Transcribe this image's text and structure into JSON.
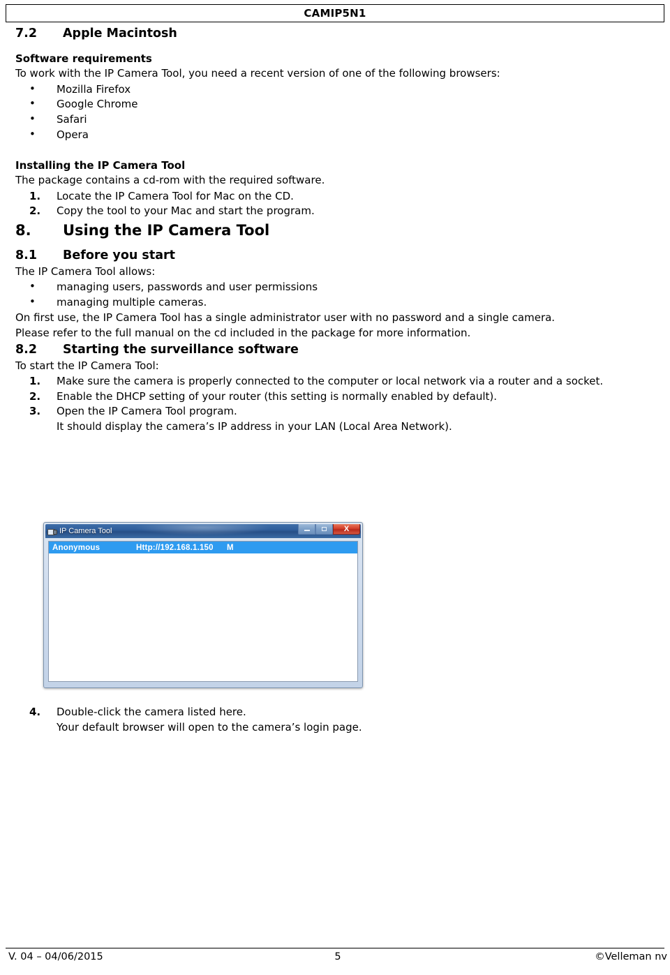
{
  "header": {
    "title": "CAMIP5N1"
  },
  "sections": {
    "s72": {
      "number": "7.2",
      "title": "Apple Macintosh"
    },
    "software_requirements": {
      "heading": "Software requirements",
      "intro": "To work with the IP Camera Tool, you need a recent version of one of the following browsers:",
      "browsers": [
        "Mozilla Firefox",
        "Google Chrome",
        "Safari",
        "Opera"
      ]
    },
    "installing": {
      "heading": "Installing the IP Camera Tool",
      "intro": "The package contains a cd-rom with the required software.",
      "steps": [
        {
          "n": "1.",
          "text": "Locate the IP Camera Tool for Mac on the CD."
        },
        {
          "n": "2.",
          "text": "Copy the tool to your Mac and start the program."
        }
      ]
    },
    "s8": {
      "number": "8.",
      "title": "Using the IP Camera Tool"
    },
    "s81": {
      "number": "8.1",
      "title": "Before you start",
      "intro": "The IP Camera Tool allows:",
      "bullets": [
        "managing users, passwords and user permissions",
        "managing multiple cameras."
      ],
      "para1": "On first use, the IP Camera Tool has a single administrator user with no password and a single camera.",
      "para2": "Please refer to the full manual on the cd included in the package for more information."
    },
    "s82": {
      "number": "8.2",
      "title": "Starting the surveillance software",
      "intro": "To start the IP Camera Tool:",
      "steps": [
        {
          "n": "1.",
          "text": "Make sure the camera is properly connected to the computer or local network via a router and a socket.",
          "sub": ""
        },
        {
          "n": "2.",
          "text": "Enable the DHCP setting of your router (this setting is normally enabled by default).",
          "sub": ""
        },
        {
          "n": "3.",
          "text": "Open the IP Camera Tool program.",
          "sub": "It should display the camera’s IP address in your LAN (Local Area Network)."
        }
      ],
      "steps_after": [
        {
          "n": "4.",
          "text": "Double-click the camera listed here.",
          "sub": "Your default browser will open to the camera’s login page."
        }
      ]
    }
  },
  "screenshot": {
    "window_title": "IP Camera Tool",
    "buttons": {
      "minimize": "–",
      "maximize": "□",
      "close": "X"
    },
    "camera_row": {
      "name": "Anonymous",
      "address": "Http://192.168.1.150",
      "flag": "M"
    },
    "selection_color": "#2e9bf0"
  },
  "footer": {
    "version": "V. 04 – 04/06/2015",
    "page": "5",
    "copyright": "©Velleman nv"
  }
}
